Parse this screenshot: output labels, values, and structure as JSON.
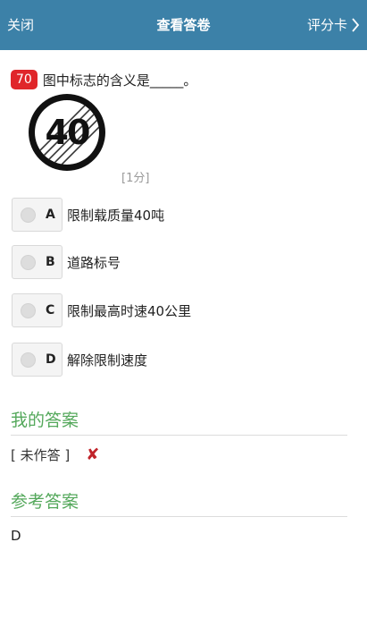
{
  "header": {
    "close_label": "关闭",
    "title": "查看答卷",
    "score_card_label": "评分卡"
  },
  "question": {
    "number": "70",
    "text": "图中标志的含义是_____。",
    "score": "[1分]",
    "sign_text": "40"
  },
  "options": [
    {
      "letter": "A",
      "text": "限制载质量40吨"
    },
    {
      "letter": "B",
      "text": "道路标号"
    },
    {
      "letter": "C",
      "text": "限制最高时速40公里"
    },
    {
      "letter": "D",
      "text": "解除限制速度"
    }
  ],
  "my_answer": {
    "title": "我的答案",
    "value": "[ 未作答 ]",
    "mark": "✘"
  },
  "reference_answer": {
    "title": "参考答案",
    "value": "D"
  },
  "colors": {
    "header_bg": "#3c81a8",
    "accent_green": "#54a85b",
    "badge_red": "#e0262a"
  }
}
